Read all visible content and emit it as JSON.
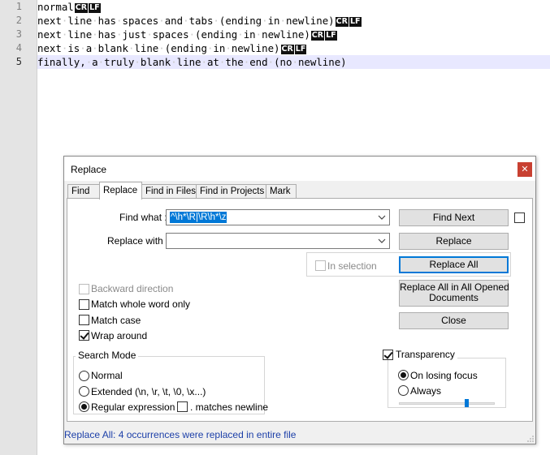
{
  "editor": {
    "line_numbers": [
      "1",
      "2",
      "3",
      "4",
      "5"
    ],
    "lines": [
      {
        "text": "normal",
        "eol": [
          "CR",
          "LF"
        ]
      },
      {
        "text": "next·line·has·spaces·and·tabs·(ending·in·newline)",
        "eol": [
          "CR",
          "LF"
        ]
      },
      {
        "text": "next·line·has·just·spaces·(ending·in·newline)",
        "eol": [
          "CR",
          "LF"
        ]
      },
      {
        "text": "next·is·a·blank·line·(ending·in·newline)",
        "eol": [
          "CR",
          "LF"
        ]
      },
      {
        "text": "finally,·a·truly·blank·line·at·the·end·(no·newline)",
        "eol": []
      }
    ],
    "current_line_color": "#e8e8ff"
  },
  "dialog": {
    "title": "Replace",
    "close_icon": "close-icon",
    "tabs": [
      "Find",
      "Replace",
      "Find in Files",
      "Find in Projects",
      "Mark"
    ],
    "active_tab": "Replace",
    "find_what_label": "Find what :",
    "find_what_value": "^\\h*\\R|\\R\\h*\\z",
    "replace_with_label": "Replace with :",
    "replace_with_value": "",
    "buttons": {
      "find_next": "Find Next",
      "replace": "Replace",
      "replace_all": "Replace All",
      "replace_all_opened_1": "Replace All in All Opened",
      "replace_all_opened_2": "Documents",
      "close": "Close"
    },
    "in_selection_label": "In selection",
    "options": {
      "backward_direction": "Backward direction",
      "match_whole_word": "Match whole word only",
      "match_case": "Match case",
      "wrap_around": "Wrap around"
    },
    "search_mode": {
      "title": "Search Mode",
      "normal": "Normal",
      "extended": "Extended (\\n, \\r, \\t, \\0, \\x...)",
      "regex": "Regular expression",
      "matches_newline": ". matches newline",
      "selected": "regex"
    },
    "transparency": {
      "title": "Transparency",
      "on_losing_focus": "On losing focus",
      "always": "Always",
      "selected": "on_losing_focus",
      "slider_level": 0.7
    },
    "status": "Replace All: 4 occurrences were replaced in entire file",
    "accent_color": "#0078d7",
    "status_color": "#1c3fa8"
  }
}
